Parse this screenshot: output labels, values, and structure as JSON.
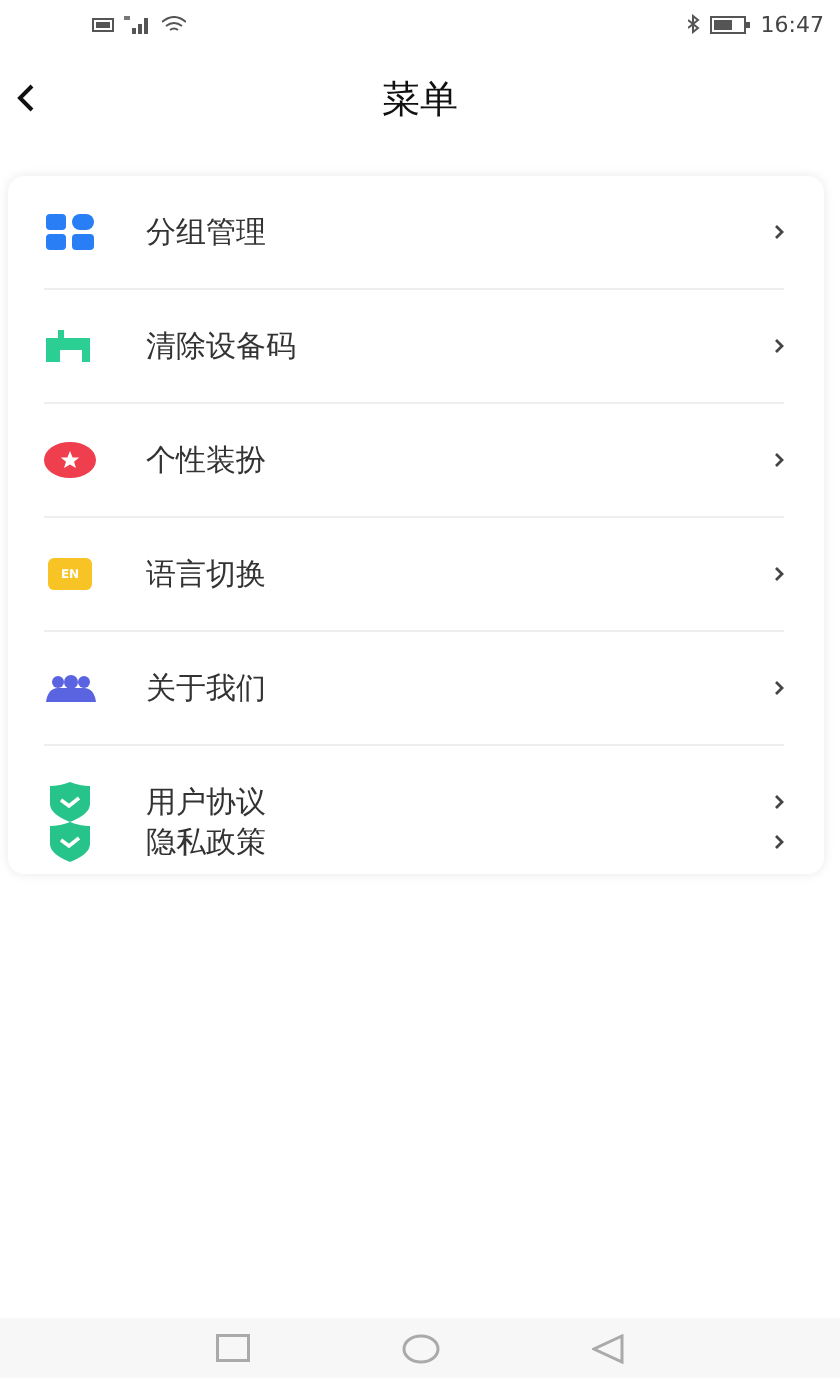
{
  "status_bar": {
    "time": "16:47"
  },
  "header": {
    "title": "菜单"
  },
  "menu": [
    {
      "kind": "row",
      "label": "分组管理"
    },
    {
      "kind": "row",
      "label": "清除设备码"
    },
    {
      "kind": "row",
      "label": "个性装扮"
    },
    {
      "kind": "row",
      "badge": "EN",
      "label": "语言切换"
    },
    {
      "kind": "row",
      "label": "关于我们"
    },
    {
      "kind": "compact",
      "label": "用户协议"
    },
    {
      "kind": "compact",
      "label": "隐私政策"
    }
  ]
}
